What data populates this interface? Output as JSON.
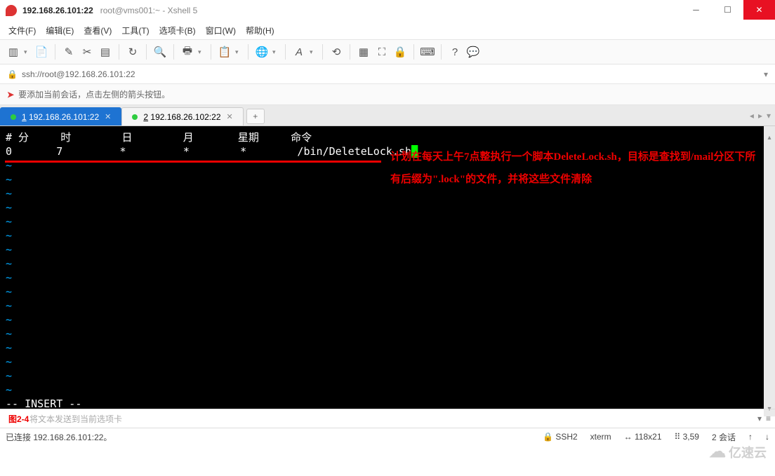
{
  "window": {
    "host": "192.168.26.101:22",
    "subtitle": "root@vms001:~ - Xshell 5"
  },
  "menu": {
    "file": "文件(F)",
    "edit": "编辑(E)",
    "view": "查看(V)",
    "tools": "工具(T)",
    "tabs": "选项卡(B)",
    "window": "窗口(W)",
    "help": "帮助(H)"
  },
  "address": {
    "url": "ssh://root@192.168.26.101:22"
  },
  "hint": {
    "text": "要添加当前会话，点击左侧的箭头按钮。"
  },
  "tabs": {
    "t1": {
      "num": "1",
      "label": "192.168.26.101:22"
    },
    "t2": {
      "num": "2",
      "label": "192.168.26.102:22"
    }
  },
  "terminal": {
    "header": "# 分     时        日        月       星期     命令",
    "cron": "0       7         *         *        *        /bin/DeleteLock.sh",
    "mode": "-- INSERT --",
    "annotation": "计划在每天上午7点整执行一个脚本DeleteLock.sh，目标是查找到/mail分区下所有后缀为\".lock\"的文件，并将这些文件清除"
  },
  "bottominput": {
    "figure": "图2-4",
    "placeholder": "将文本发送到当前选项卡"
  },
  "status": {
    "connected": "已连接 192.168.26.101:22。",
    "ssh": "SSH2",
    "term": "xterm",
    "size": "118x21",
    "pos": "3,59",
    "sessions": "2 会话"
  },
  "watermark": "亿速云"
}
